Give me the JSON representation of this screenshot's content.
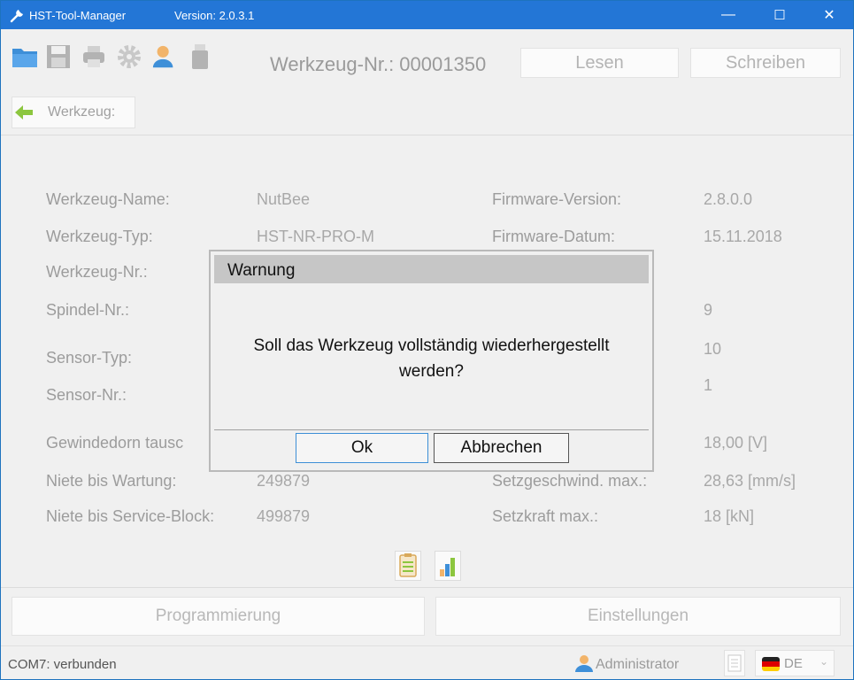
{
  "window": {
    "title": "HST-Tool-Manager",
    "version": "Version: 2.0.3.1",
    "minimize": "—",
    "maximize": "☐",
    "close": "✕"
  },
  "toolbar": {
    "tool_number": "Werkzeug-Nr.: 00001350",
    "read_label": "Lesen",
    "write_label": "Schreiben"
  },
  "breadcrumb": {
    "label": "Werkzeug:"
  },
  "fields": {
    "left": [
      {
        "label": "Werkzeug-Name:",
        "value": "NutBee"
      },
      {
        "label": "Werkzeug-Typ:",
        "value": "HST-NR-PRO-M"
      },
      {
        "label": "Werkzeug-Nr.:",
        "value": ""
      },
      {
        "label": "Spindel-Nr.:",
        "value": ""
      },
      {
        "label": "Sensor-Typ:",
        "value": ""
      },
      {
        "label": "Sensor-Nr.:",
        "value": ""
      },
      {
        "label": "Gewindedorn tausc",
        "value": ""
      },
      {
        "label": "Niete bis Wartung:",
        "value": "249879"
      },
      {
        "label": "Niete bis Service-Block:",
        "value": "499879"
      }
    ],
    "right": [
      {
        "label": "Firmware-Version:",
        "value": "2.8.0.0"
      },
      {
        "label": "Firmware-Datum:",
        "value": "15.11.2018"
      },
      {
        "label": "",
        "value": "9"
      },
      {
        "label": "",
        "value": "10"
      },
      {
        "label": "",
        "value": "1"
      },
      {
        "label": "",
        "value": "18,00 [V]"
      },
      {
        "label": "Setzgeschwind. max.:",
        "value": "28,63 [mm/s]"
      },
      {
        "label": "Setzkraft max.:",
        "value": "18 [kN]"
      }
    ]
  },
  "bottom": {
    "programming_label": "Programmierung",
    "settings_label": "Einstellungen"
  },
  "status": {
    "connection": "COM7: verbunden",
    "user": "Administrator",
    "language": "DE"
  },
  "dialog": {
    "title": "Warnung",
    "message_line1": "Soll das Werkzeug vollständig wiederhergestellt",
    "message_line2": "werden?",
    "ok_label": "Ok",
    "cancel_label": "Abbrechen"
  },
  "colors": {
    "titlebar": "#2376d6",
    "accent_blue": "#3e8fd8",
    "dialog_header": "#c6c6c6"
  }
}
